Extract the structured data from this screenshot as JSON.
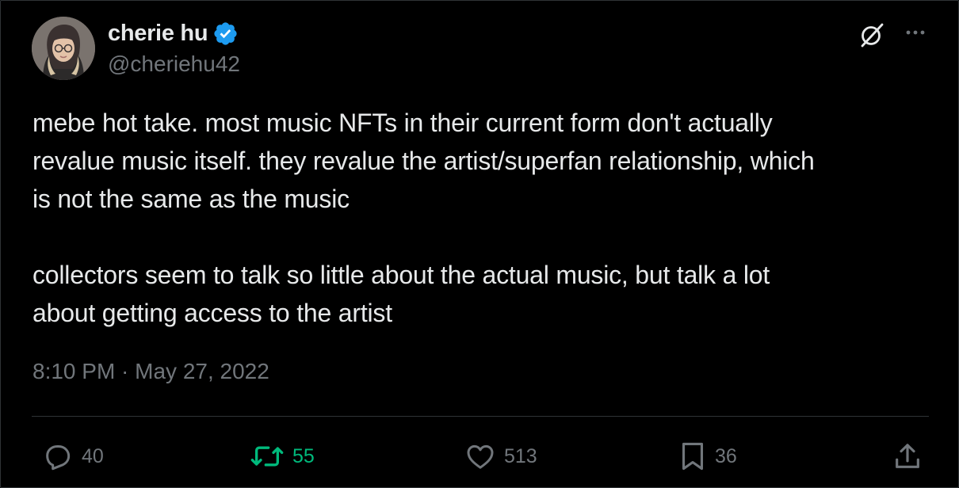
{
  "author": {
    "display_name": "cherie hu",
    "handle": "@cheriehu42",
    "verified": true
  },
  "tweet": {
    "paragraphs": [
      "mebe hot take. most music NFTs in their current form don't actually\nrevalue music itself. they revalue the artist/superfan relationship, which\nis not the same as the music",
      "collectors seem to talk so little about the actual music, but talk a lot\nabout getting access to the artist"
    ],
    "timestamp": "8:10 PM · May 27, 2022"
  },
  "actions": {
    "replies": "40",
    "retweets": "55",
    "likes": "513",
    "bookmarks": "36"
  },
  "icons": {
    "header": [
      "grok-icon",
      "more-icon"
    ],
    "actions": [
      "reply-icon",
      "retweet-icon",
      "like-icon",
      "bookmark-icon",
      "share-icon"
    ]
  },
  "colors": {
    "background": "#000000",
    "text": "#e7e9ea",
    "muted": "#71767b",
    "verified": "#1d9bf0",
    "retweet_active": "#00ba7c",
    "divider": "#2f3336"
  }
}
